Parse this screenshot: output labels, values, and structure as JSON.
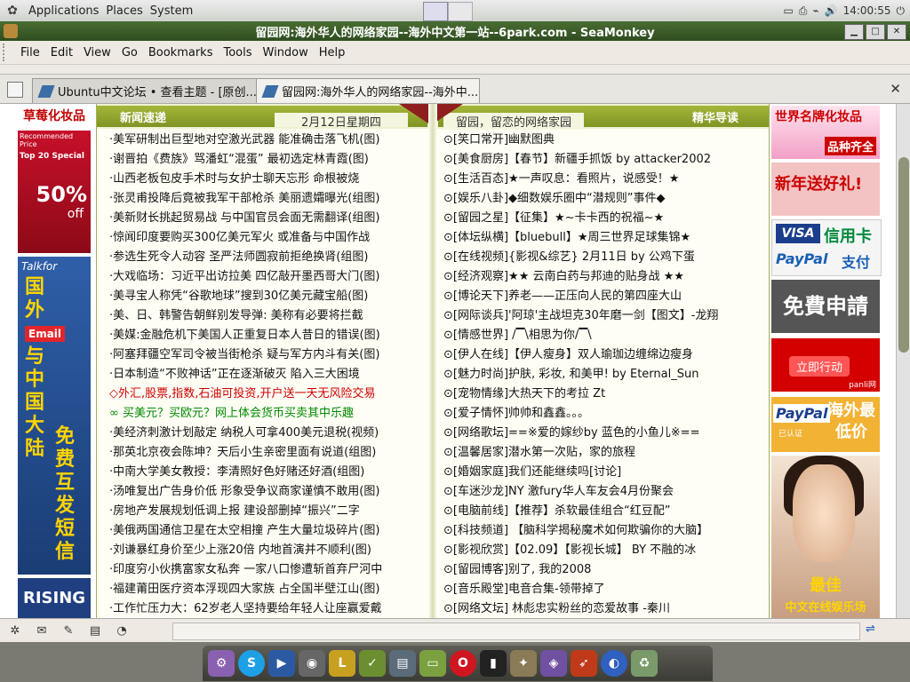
{
  "panel": {
    "menus": [
      "Applications",
      "Places",
      "System"
    ],
    "clock": "14:00:55"
  },
  "window": {
    "title": "留园网:海外华人的网络家园--海外中文第一站--6park.com - SeaMonkey"
  },
  "menubar": {
    "items": [
      "File",
      "Edit",
      "View",
      "Go",
      "Bookmarks",
      "Tools",
      "Window",
      "Help"
    ]
  },
  "tabs": [
    {
      "label": "Ubuntu中文论坛 • 查看主题 - [原创...",
      "active": false
    },
    {
      "label": "留园网:海外华人的网络家园--海外中...",
      "active": true
    }
  ],
  "leftad": {
    "header": "草莓化妆品",
    "ad1": {
      "line1": "Recommended Price",
      "line2": "Top 20 Special",
      "big": "50%",
      "off": "off"
    },
    "ad2": {
      "brand": "Talkfor",
      "chars1": "国外",
      "email": "Email",
      "chars2": "与中国大陆",
      "chars3": "免费互发短信"
    },
    "ad3": "RISING"
  },
  "news": {
    "left_title": "新闻速递",
    "date": "2月12日星期四",
    "right_subtitle": "留园，留恋的网络家园",
    "right_title": "精华导读",
    "left_items": [
      {
        "text": "·美军研制出巨型地对空激光武器 能准确击落飞机(图)",
        "style": ""
      },
      {
        "text": "·谢晋拍《费族》骂潘虹“混蛋” 最初选定林青霞(图)",
        "style": ""
      },
      {
        "text": "·山西老板包皮手术时与女护士聊天忘形 命根被烧",
        "style": ""
      },
      {
        "text": "·张灵甫投降后竟被我军干部枪杀 美丽遗孀曝光(组图)",
        "style": ""
      },
      {
        "text": "·美新财长挑起贸易战 与中国官员会面无需翻译(组图)",
        "style": ""
      },
      {
        "text": "·惊闻印度要购买300亿美元军火 或准备与中国作战",
        "style": ""
      },
      {
        "text": "·参选生死令人动容 圣严法师圆寂前拒绝换肾(组图)",
        "style": ""
      },
      {
        "text": "·大戏临场：习近平出访拉美 四亿敲开墨西哥大门(图)",
        "style": ""
      },
      {
        "text": "·美寻宝人称凭“谷歌地球”搜到30亿美元藏宝船(图)",
        "style": ""
      },
      {
        "text": "·美、日、韩警告朝鲜别发导弹: 美称有必要将拦截",
        "style": ""
      },
      {
        "text": "·美媒:金融危机下美国人正重复日本人昔日的错误(图)",
        "style": ""
      },
      {
        "text": "·阿塞拜疆空军司令被当街枪杀 疑与军方内斗有关(图)",
        "style": ""
      },
      {
        "text": "·日本制造“不败神话”正在逐渐破灭 陷入三大困境",
        "style": ""
      },
      {
        "text": "◇外汇,股票,指数,石油可投资,开户送一天无风险交易",
        "style": "red"
      },
      {
        "text": "∞ 买美元？买欧元？网上体会货币买卖其中乐趣",
        "style": "green"
      },
      {
        "text": "·美经济刺激计划敲定 纳税人可拿400美元退税(视频)",
        "style": ""
      },
      {
        "text": "·那英北京夜会陈坤？天后小生亲密里面有说道(组图)",
        "style": ""
      },
      {
        "text": "·中南大学美女教授：李清照好色好赌还好酒(组图)",
        "style": ""
      },
      {
        "text": "·汤唯复出广告身价低 形象受争议商家谨慎不敢用(图)",
        "style": ""
      },
      {
        "text": "·房地产发展规划低调上报 建设部删掉“振兴”二字",
        "style": ""
      },
      {
        "text": "·美俄两国通信卫星在太空相撞 产生大量垃圾碎片(图)",
        "style": ""
      },
      {
        "text": "·刘谦暴红身价至少上涨20倍 内地首演并不顺利(图)",
        "style": ""
      },
      {
        "text": "·印度穷小伙携富家女私奔 一家八口惨遭斩首弃尸河中",
        "style": ""
      },
      {
        "text": "·福建莆田医疗资本浮现四大家族 占全国半壁江山(图)",
        "style": ""
      },
      {
        "text": "·工作忙压力大：62岁老人坚持要给年轻人让座赢爱戴",
        "style": ""
      }
    ],
    "right_items": [
      "⊙[笑口常开]幽默图典",
      "⊙[美食厨房]【春节】新疆手抓饭 by attacker2002",
      "⊙[生活百态]★一声叹息：看照片，说感受！★",
      "⊙[娱乐八卦]◆细数娱乐圈中“潜规则”事件◆",
      "⊙[留园之星]【征集】★~卡卡西的祝福~★",
      "⊙[体坛纵横]【bluebull】★周三世界足球集锦★",
      "⊙[在线视频]{影视&综艺} 2月11日 by 公鸡下蛋",
      "⊙[经济观察]★★ 云南白药与邦迪的贴身战 ★★",
      "⊙[博论天下]养老——正压向人民的第四座大山",
      "⊙[网际谈兵]'阿琼'主战坦克30年磨一剑【图文】-龙翔",
      "⊙[情感世界] /▔\\相思为你/▔\\",
      "⊙[伊人在线]【伊人瘦身】双人瑜珈边缠绵边瘦身",
      "⊙[魅力时尚]护肤, 彩妆, 和美甲! by Eternal_Sun",
      "⊙[宠物情缘]大热天下的考拉 Zt",
      "⊙[爱子情怀]帅帅和鑫鑫。。。",
      "⊙[网络歌坛]==※爱的嫁纱by 蓝色的小鱼儿※==",
      "⊙[温馨居家]潜水第一次贴，家的旅程",
      "⊙[婚姻家庭]我们还能继续吗[讨论]",
      "⊙[车迷沙龙]NY 激fury华人车友会4月份聚会",
      "⊙[电脑前线]【推荐】杀软最佳组合“红豆配”",
      "⊙[科技频道] 【脑科学揭秘魔术如何欺骗你的大脑】",
      "⊙[影视欣赏]【02.09】【影视长城】 BY 不融的冰",
      "⊙[留园博客]别了, 我的2008",
      "⊙[音乐殿堂]电音合集-领带掉了",
      "⊙[网络文坛] 林彪忠实粉丝的恋爱故事 -秦川"
    ]
  },
  "rightad": {
    "b1": {
      "title": "世界名牌化妆品",
      "sub": "品种齐全"
    },
    "b2": "新年送好礼!",
    "b3": {
      "visa": "VISA",
      "card": "信用卡",
      "paypal": "PayPal",
      "pay": "支付"
    },
    "b4": "免費申請",
    "b5": {
      "btn": "立即行动",
      "brand": "panli网"
    },
    "b6": {
      "paypal": "PayPal",
      "verified": "已认证",
      "text": "海外最低价"
    },
    "b7": {
      "t1": "最佳",
      "t2": "中文在线娱乐场"
    }
  },
  "dock": {
    "icons": [
      "settings-icon",
      "skype-icon",
      "media-player-icon",
      "webcam-icon",
      "lyx-icon",
      "editor-icon",
      "document-viewer-icon",
      "files-icon",
      "opera-icon",
      "terminal-icon",
      "gimp-icon",
      "pidgin-icon",
      "parrot-icon",
      "browser-icon",
      "trash-icon"
    ]
  }
}
